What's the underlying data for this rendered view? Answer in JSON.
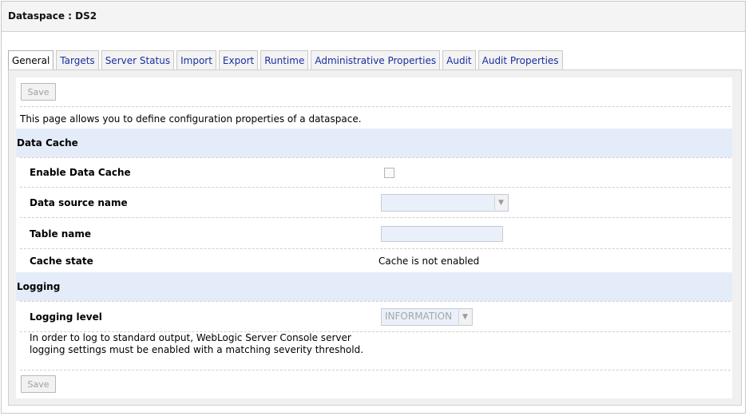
{
  "header": {
    "title": "Dataspace : DS2"
  },
  "tabs": [
    {
      "label": "General",
      "active": true
    },
    {
      "label": "Targets"
    },
    {
      "label": "Server Status"
    },
    {
      "label": "Import"
    },
    {
      "label": "Export"
    },
    {
      "label": "Runtime"
    },
    {
      "label": "Administrative Properties"
    },
    {
      "label": "Audit"
    },
    {
      "label": "Audit Properties"
    }
  ],
  "toolbar": {
    "save_label": "Save"
  },
  "intro": "This page allows you to define configuration properties of a dataspace.",
  "data_cache": {
    "heading": "Data Cache",
    "enable_label": "Enable Data Cache",
    "enable_checked": false,
    "datasource_label": "Data source name",
    "datasource_value": "",
    "table_label": "Table name",
    "table_value": "",
    "state_label": "Cache state",
    "state_value": "Cache is not enabled"
  },
  "logging": {
    "heading": "Logging",
    "level_label": "Logging level",
    "level_value": "INFORMATION",
    "note_line1": "In order to log to standard output, WebLogic Server Console server",
    "note_line2": "logging settings must be enabled with a matching severity threshold."
  },
  "colors": {
    "section_bg": "#e5ecf9",
    "tab_link": "#1a2fa0",
    "input_bg": "#eaf0fa"
  }
}
